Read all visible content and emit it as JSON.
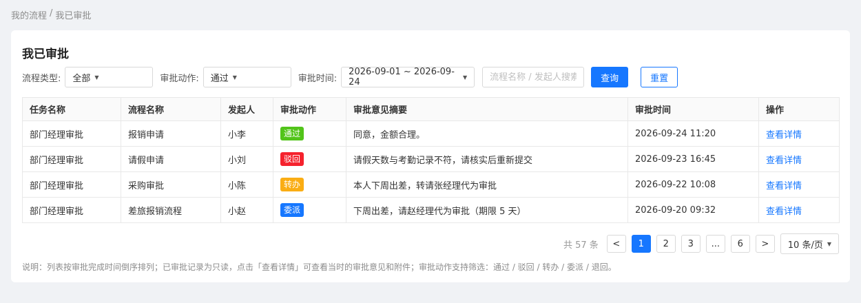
{
  "breadcrumb": {
    "items": [
      "我的流程",
      "/",
      "我已审批"
    ]
  },
  "page": {
    "title": "我已审批"
  },
  "filters": {
    "process_type_label": "流程类型:",
    "process_type_value": "全部",
    "action_label": "审批动作:",
    "action_value": "通过",
    "time_label": "审批时间:",
    "time_value": "2026-09-01 ~ 2026-09-24",
    "search_placeholder": "流程名称 / 发起人搜索",
    "search_value": "",
    "query_label": "查询",
    "reset_label": "重置"
  },
  "table": {
    "columns": [
      "任务名称",
      "流程名称",
      "发起人",
      "审批动作",
      "审批意见摘要",
      "审批时间",
      "操作"
    ],
    "rows": [
      {
        "task": "部门经理审批",
        "process": "报销申请",
        "initiator": "小李",
        "action": "通过",
        "action_color": "#52c41a",
        "summary": "同意，金额合理。",
        "time": "2026-09-24 11:20",
        "op": "查看详情"
      },
      {
        "task": "部门经理审批",
        "process": "请假申请",
        "initiator": "小刘",
        "action": "驳回",
        "action_color": "#f5222d",
        "summary": "请假天数与考勤记录不符，请核实后重新提交",
        "time": "2026-09-23 16:45",
        "op": "查看详情"
      },
      {
        "task": "部门经理审批",
        "process": "采购审批",
        "initiator": "小陈",
        "action": "转办",
        "action_color": "#faad14",
        "summary": "本人下周出差，转请张经理代为审批",
        "time": "2026-09-22 10:08",
        "op": "查看详情"
      },
      {
        "task": "部门经理审批",
        "process": "差旅报销流程",
        "initiator": "小赵",
        "action": "委派",
        "action_color": "#1677ff",
        "summary": "下周出差，请赵经理代为审批（期限 5 天）",
        "time": "2026-09-20 09:32",
        "op": "查看详情"
      }
    ]
  },
  "pagination": {
    "total": "共 57 条",
    "prev": "<",
    "next": ">",
    "pages": [
      "1",
      "2",
      "3",
      "...",
      "6"
    ],
    "current": "1",
    "page_size": "10 条/页"
  },
  "note": "说明：列表按审批完成时间倒序排列；已审批记录为只读，点击「查看详情」可查看当时的审批意见和附件；审批动作支持筛选：通过 / 驳回 / 转办 / 委派 / 退回。",
  "colors": {
    "primary": "#1677ff",
    "pass": "#52c41a",
    "reject": "#f5222d",
    "transfer": "#faad14",
    "delegate": "#1677ff"
  }
}
